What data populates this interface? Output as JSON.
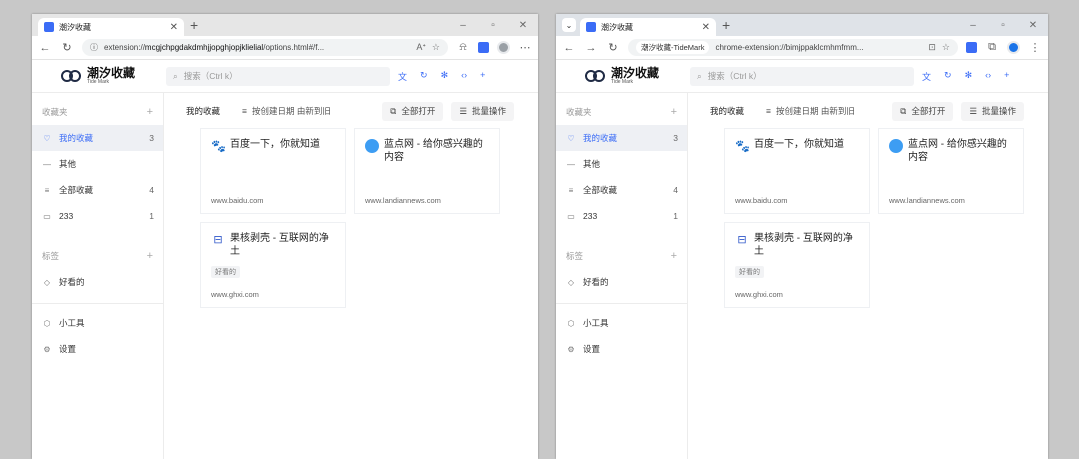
{
  "w1": {
    "tab_title": "潮汐收藏",
    "address": {
      "prefix": "extension://",
      "host": "mcgjchpgdakdmhjjopghjopjklielial",
      "path": "/options.html#/f..."
    }
  },
  "w2": {
    "tab_title": "潮汐收藏",
    "address": {
      "chip": "潮汐收藏-TideMark",
      "url": "chrome-extension://bimjppaklcmhmfmm..."
    }
  },
  "app": {
    "brand": {
      "name": "潮汐收藏",
      "sub": "Tide Mark"
    },
    "search_placeholder": "搜索（Ctrl k）",
    "sidebar": {
      "favorites_heading": "收藏夹",
      "favorites": [
        {
          "label": "我的收藏",
          "count": "3",
          "icon": "heart-icon",
          "active": true
        },
        {
          "label": "其他",
          "count": "",
          "icon": "dash-icon",
          "active": false
        },
        {
          "label": "全部收藏",
          "count": "4",
          "icon": "list-icon",
          "active": false
        },
        {
          "label": "233",
          "count": "1",
          "icon": "folder-icon",
          "active": false
        }
      ],
      "tags_heading": "标签",
      "tags": [
        {
          "label": "好看的",
          "icon": "tag-icon"
        }
      ],
      "tools": [
        {
          "label": "小工具",
          "icon": "cube-icon"
        },
        {
          "label": "设置",
          "icon": "gear-icon"
        }
      ]
    },
    "main": {
      "title": "我的收藏",
      "sort_label": "按创建日期 由新到旧",
      "open_all_label": "全部打开",
      "batch_label": "批量操作",
      "cards": [
        {
          "title": "百度一下，你就知道",
          "url": "www.baidu.com",
          "icon": "baidu-paw-icon",
          "tag": ""
        },
        {
          "title": "蓝点网 - 给你感兴趣的内容",
          "url": "www.landiannews.com",
          "icon": "landian-logo-icon",
          "tag": ""
        },
        {
          "title": "果核剥壳 - 互联网的净土",
          "url": "www.ghxi.com",
          "icon": "ghxi-box-icon",
          "tag": "好看的"
        }
      ]
    }
  }
}
